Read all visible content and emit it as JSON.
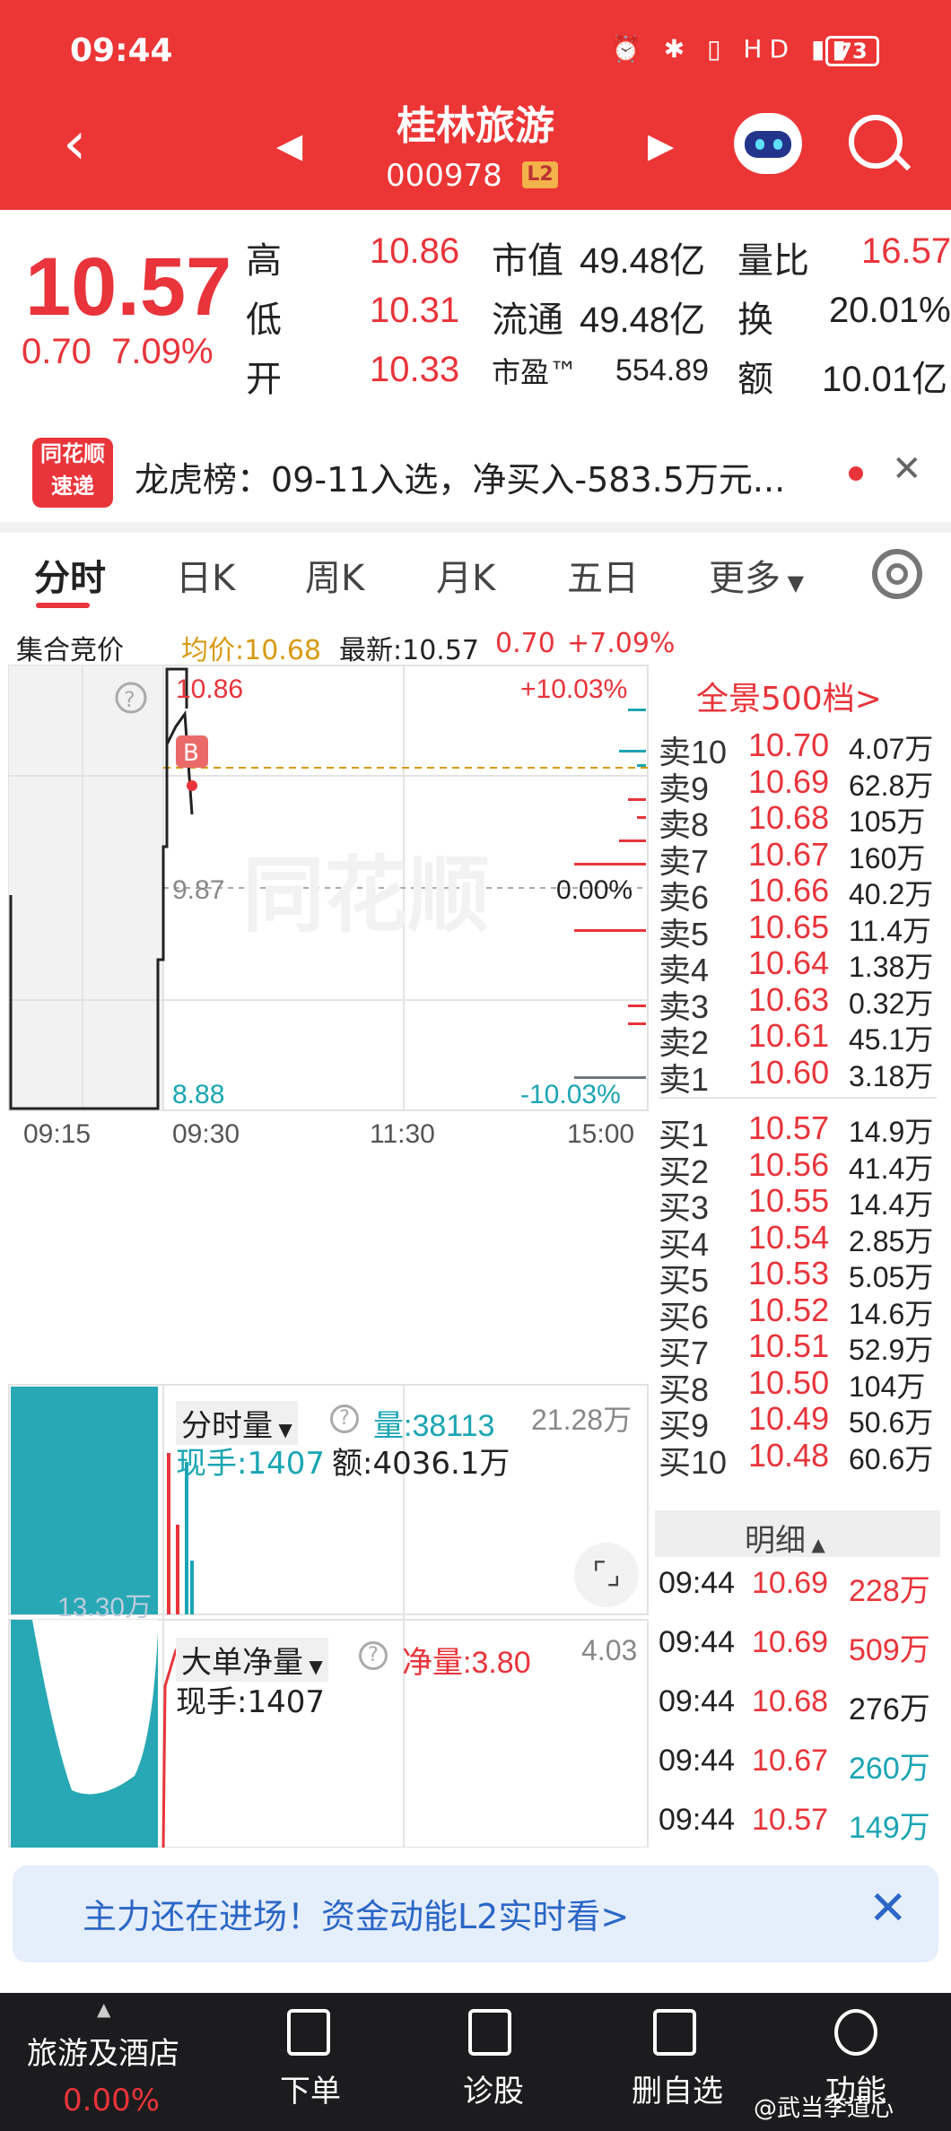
{
  "status": {
    "time": "09:44",
    "battery": "73"
  },
  "header": {
    "title": "桂林旅游",
    "code": "000978",
    "level_badge": "L2"
  },
  "quote": {
    "price": "10.57",
    "change": "0.70",
    "change_pct": "7.09%",
    "rows": [
      {
        "l1": "高",
        "v1": "10.86",
        "l2": "市值",
        "v2": "49.48亿",
        "l3": "量比",
        "v3": "16.57"
      },
      {
        "l1": "低",
        "v1": "10.31",
        "l2": "流通",
        "v2": "49.48亿",
        "l3": "换",
        "v3": "20.01%"
      },
      {
        "l1": "开",
        "v1": "10.33",
        "l2": "市盈™",
        "v2": "554.89",
        "l3": "额",
        "v3": "10.01亿"
      }
    ]
  },
  "news": {
    "logo_top": "同花顺",
    "logo_bottom": "速递",
    "text": "龙虎榜：09-11入选，净买入-583.5万元..."
  },
  "tabs": [
    "分时",
    "日K",
    "周K",
    "月K",
    "五日",
    "更多"
  ],
  "info_row": {
    "label": "集合竞价",
    "avg": "均价:10.68",
    "latest": "最新:10.57",
    "chg": "0.70",
    "pct": "+7.09%"
  },
  "chart": {
    "high": "10.86",
    "high_pct": "+10.03%",
    "mid": "9.87",
    "mid_pct": "0.00%",
    "low": "8.88",
    "low_pct": "-10.03%",
    "t1": "09:15",
    "t2": "09:30",
    "t3": "11:30",
    "t4": "15:00",
    "marker": "B",
    "watermark": "同花顺"
  },
  "orderbook": {
    "title": "全景500档>",
    "sells": [
      {
        "label": "卖10",
        "price": "10.70",
        "vol": "4.07万"
      },
      {
        "label": "卖9",
        "price": "10.69",
        "vol": "62.8万"
      },
      {
        "label": "卖8",
        "price": "10.68",
        "vol": "105万"
      },
      {
        "label": "卖7",
        "price": "10.67",
        "vol": "160万"
      },
      {
        "label": "卖6",
        "price": "10.66",
        "vol": "40.2万"
      },
      {
        "label": "卖5",
        "price": "10.65",
        "vol": "11.4万"
      },
      {
        "label": "卖4",
        "price": "10.64",
        "vol": "1.38万"
      },
      {
        "label": "卖3",
        "price": "10.63",
        "vol": "0.32万"
      },
      {
        "label": "卖2",
        "price": "10.61",
        "vol": "45.1万"
      },
      {
        "label": "卖1",
        "price": "10.60",
        "vol": "3.18万"
      }
    ],
    "buys": [
      {
        "label": "买1",
        "price": "10.57",
        "vol": "14.9万"
      },
      {
        "label": "买2",
        "price": "10.56",
        "vol": "41.4万"
      },
      {
        "label": "买3",
        "price": "10.55",
        "vol": "14.4万"
      },
      {
        "label": "买4",
        "price": "10.54",
        "vol": "2.85万"
      },
      {
        "label": "买5",
        "price": "10.53",
        "vol": "5.05万"
      },
      {
        "label": "买6",
        "price": "10.52",
        "vol": "14.6万"
      },
      {
        "label": "买7",
        "price": "10.51",
        "vol": "52.9万"
      },
      {
        "label": "买8",
        "price": "10.50",
        "vol": "104万"
      },
      {
        "label": "买9",
        "price": "10.49",
        "vol": "50.6万"
      },
      {
        "label": "买10",
        "price": "10.48",
        "vol": "60.6万"
      }
    ]
  },
  "volume_panel": {
    "name": "分时量",
    "vol": "量:38113",
    "hand": "现手:1407",
    "amount": "额:4036.1万",
    "max": "21.28万",
    "mid": "13.30万"
  },
  "net_panel": {
    "name": "大单净量",
    "net": "净量:3.80",
    "hand": "现手:1407",
    "max": "4.03"
  },
  "details": {
    "title": "明细",
    "rows": [
      {
        "time": "09:44",
        "price": "10.69",
        "vol": "228万",
        "color": "#e8343a"
      },
      {
        "time": "09:44",
        "price": "10.69",
        "vol": "509万",
        "color": "#e8343a"
      },
      {
        "time": "09:44",
        "price": "10.68",
        "vol": "276万",
        "color": "#222222"
      },
      {
        "time": "09:44",
        "price": "10.67",
        "vol": "260万",
        "color": "#1aa5b4"
      },
      {
        "time": "09:44",
        "price": "10.57",
        "vol": "149万",
        "color": "#1aa5b4"
      }
    ]
  },
  "promo": {
    "text": "主力还在进场！资金动能L2实时看>"
  },
  "bottom": {
    "sector": "旅游及酒店",
    "sector_pct": "0.00%",
    "items": [
      "下单",
      "诊股",
      "删自选",
      "功能"
    ],
    "watermark": "@武当李道心"
  },
  "colors": {
    "up": "#e8343a",
    "down": "#1aa5b4",
    "header": "#ec3535"
  }
}
